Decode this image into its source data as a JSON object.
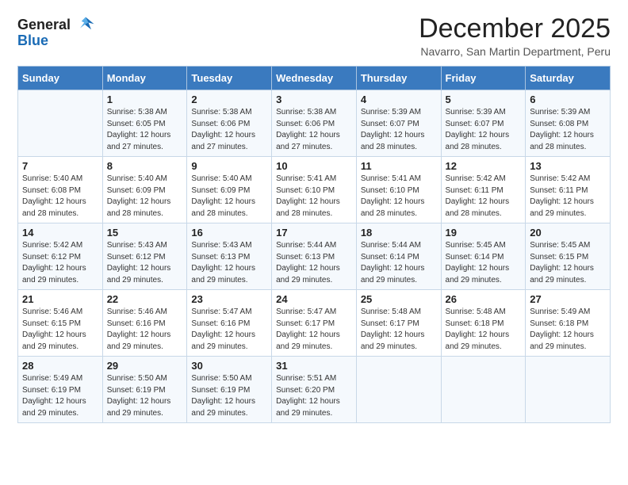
{
  "logo": {
    "general": "General",
    "blue": "Blue"
  },
  "title": "December 2025",
  "subtitle": "Navarro, San Martin Department, Peru",
  "days_of_week": [
    "Sunday",
    "Monday",
    "Tuesday",
    "Wednesday",
    "Thursday",
    "Friday",
    "Saturday"
  ],
  "weeks": [
    [
      {
        "day": "",
        "sunrise": "",
        "sunset": "",
        "daylight": ""
      },
      {
        "day": "1",
        "sunrise": "Sunrise: 5:38 AM",
        "sunset": "Sunset: 6:05 PM",
        "daylight": "Daylight: 12 hours and 27 minutes."
      },
      {
        "day": "2",
        "sunrise": "Sunrise: 5:38 AM",
        "sunset": "Sunset: 6:06 PM",
        "daylight": "Daylight: 12 hours and 27 minutes."
      },
      {
        "day": "3",
        "sunrise": "Sunrise: 5:38 AM",
        "sunset": "Sunset: 6:06 PM",
        "daylight": "Daylight: 12 hours and 27 minutes."
      },
      {
        "day": "4",
        "sunrise": "Sunrise: 5:39 AM",
        "sunset": "Sunset: 6:07 PM",
        "daylight": "Daylight: 12 hours and 28 minutes."
      },
      {
        "day": "5",
        "sunrise": "Sunrise: 5:39 AM",
        "sunset": "Sunset: 6:07 PM",
        "daylight": "Daylight: 12 hours and 28 minutes."
      },
      {
        "day": "6",
        "sunrise": "Sunrise: 5:39 AM",
        "sunset": "Sunset: 6:08 PM",
        "daylight": "Daylight: 12 hours and 28 minutes."
      }
    ],
    [
      {
        "day": "7",
        "sunrise": "Sunrise: 5:40 AM",
        "sunset": "Sunset: 6:08 PM",
        "daylight": "Daylight: 12 hours and 28 minutes."
      },
      {
        "day": "8",
        "sunrise": "Sunrise: 5:40 AM",
        "sunset": "Sunset: 6:09 PM",
        "daylight": "Daylight: 12 hours and 28 minutes."
      },
      {
        "day": "9",
        "sunrise": "Sunrise: 5:40 AM",
        "sunset": "Sunset: 6:09 PM",
        "daylight": "Daylight: 12 hours and 28 minutes."
      },
      {
        "day": "10",
        "sunrise": "Sunrise: 5:41 AM",
        "sunset": "Sunset: 6:10 PM",
        "daylight": "Daylight: 12 hours and 28 minutes."
      },
      {
        "day": "11",
        "sunrise": "Sunrise: 5:41 AM",
        "sunset": "Sunset: 6:10 PM",
        "daylight": "Daylight: 12 hours and 28 minutes."
      },
      {
        "day": "12",
        "sunrise": "Sunrise: 5:42 AM",
        "sunset": "Sunset: 6:11 PM",
        "daylight": "Daylight: 12 hours and 28 minutes."
      },
      {
        "day": "13",
        "sunrise": "Sunrise: 5:42 AM",
        "sunset": "Sunset: 6:11 PM",
        "daylight": "Daylight: 12 hours and 29 minutes."
      }
    ],
    [
      {
        "day": "14",
        "sunrise": "Sunrise: 5:42 AM",
        "sunset": "Sunset: 6:12 PM",
        "daylight": "Daylight: 12 hours and 29 minutes."
      },
      {
        "day": "15",
        "sunrise": "Sunrise: 5:43 AM",
        "sunset": "Sunset: 6:12 PM",
        "daylight": "Daylight: 12 hours and 29 minutes."
      },
      {
        "day": "16",
        "sunrise": "Sunrise: 5:43 AM",
        "sunset": "Sunset: 6:13 PM",
        "daylight": "Daylight: 12 hours and 29 minutes."
      },
      {
        "day": "17",
        "sunrise": "Sunrise: 5:44 AM",
        "sunset": "Sunset: 6:13 PM",
        "daylight": "Daylight: 12 hours and 29 minutes."
      },
      {
        "day": "18",
        "sunrise": "Sunrise: 5:44 AM",
        "sunset": "Sunset: 6:14 PM",
        "daylight": "Daylight: 12 hours and 29 minutes."
      },
      {
        "day": "19",
        "sunrise": "Sunrise: 5:45 AM",
        "sunset": "Sunset: 6:14 PM",
        "daylight": "Daylight: 12 hours and 29 minutes."
      },
      {
        "day": "20",
        "sunrise": "Sunrise: 5:45 AM",
        "sunset": "Sunset: 6:15 PM",
        "daylight": "Daylight: 12 hours and 29 minutes."
      }
    ],
    [
      {
        "day": "21",
        "sunrise": "Sunrise: 5:46 AM",
        "sunset": "Sunset: 6:15 PM",
        "daylight": "Daylight: 12 hours and 29 minutes."
      },
      {
        "day": "22",
        "sunrise": "Sunrise: 5:46 AM",
        "sunset": "Sunset: 6:16 PM",
        "daylight": "Daylight: 12 hours and 29 minutes."
      },
      {
        "day": "23",
        "sunrise": "Sunrise: 5:47 AM",
        "sunset": "Sunset: 6:16 PM",
        "daylight": "Daylight: 12 hours and 29 minutes."
      },
      {
        "day": "24",
        "sunrise": "Sunrise: 5:47 AM",
        "sunset": "Sunset: 6:17 PM",
        "daylight": "Daylight: 12 hours and 29 minutes."
      },
      {
        "day": "25",
        "sunrise": "Sunrise: 5:48 AM",
        "sunset": "Sunset: 6:17 PM",
        "daylight": "Daylight: 12 hours and 29 minutes."
      },
      {
        "day": "26",
        "sunrise": "Sunrise: 5:48 AM",
        "sunset": "Sunset: 6:18 PM",
        "daylight": "Daylight: 12 hours and 29 minutes."
      },
      {
        "day": "27",
        "sunrise": "Sunrise: 5:49 AM",
        "sunset": "Sunset: 6:18 PM",
        "daylight": "Daylight: 12 hours and 29 minutes."
      }
    ],
    [
      {
        "day": "28",
        "sunrise": "Sunrise: 5:49 AM",
        "sunset": "Sunset: 6:19 PM",
        "daylight": "Daylight: 12 hours and 29 minutes."
      },
      {
        "day": "29",
        "sunrise": "Sunrise: 5:50 AM",
        "sunset": "Sunset: 6:19 PM",
        "daylight": "Daylight: 12 hours and 29 minutes."
      },
      {
        "day": "30",
        "sunrise": "Sunrise: 5:50 AM",
        "sunset": "Sunset: 6:19 PM",
        "daylight": "Daylight: 12 hours and 29 minutes."
      },
      {
        "day": "31",
        "sunrise": "Sunrise: 5:51 AM",
        "sunset": "Sunset: 6:20 PM",
        "daylight": "Daylight: 12 hours and 29 minutes."
      },
      {
        "day": "",
        "sunrise": "",
        "sunset": "",
        "daylight": ""
      },
      {
        "day": "",
        "sunrise": "",
        "sunset": "",
        "daylight": ""
      },
      {
        "day": "",
        "sunrise": "",
        "sunset": "",
        "daylight": ""
      }
    ]
  ]
}
